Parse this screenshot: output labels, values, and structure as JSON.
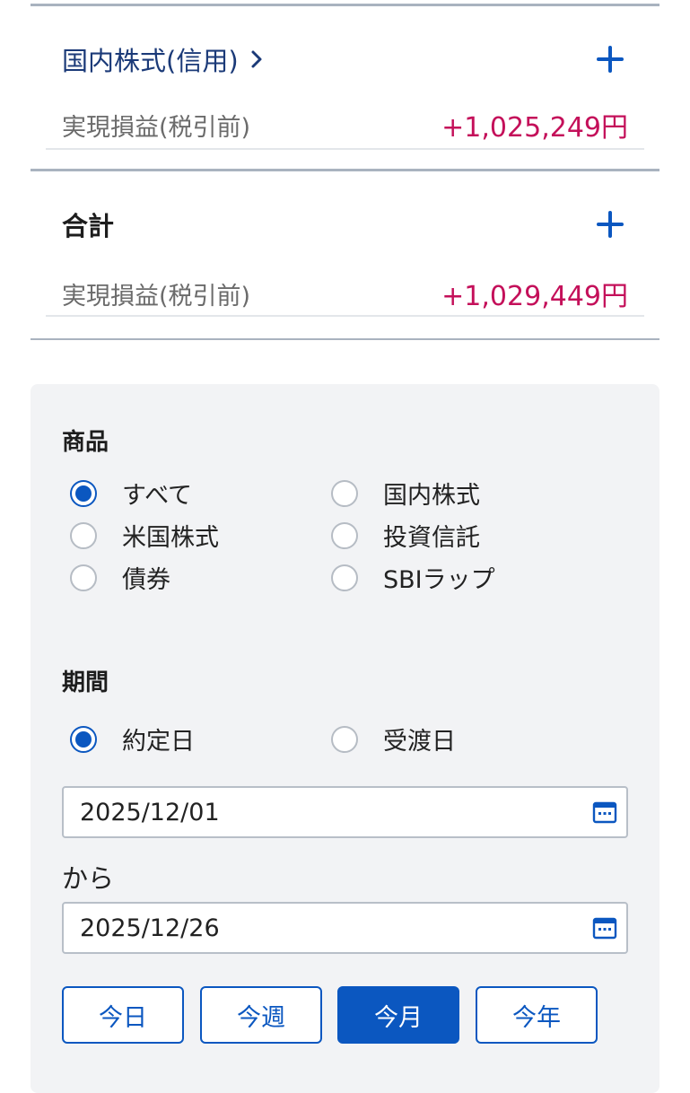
{
  "cards": [
    {
      "title": "国内株式(信用)",
      "has_chevron": true,
      "value_label": "実現損益(税引前)",
      "value": "+1,025,249円"
    },
    {
      "title": "合計",
      "has_chevron": false,
      "value_label": "実現損益(税引前)",
      "value": "+1,029,449円"
    }
  ],
  "filter": {
    "product": {
      "title": "商品",
      "options": [
        {
          "label": "すべて",
          "checked": true
        },
        {
          "label": "国内株式",
          "checked": false
        },
        {
          "label": "米国株式",
          "checked": false
        },
        {
          "label": "投資信託",
          "checked": false
        },
        {
          "label": "債券",
          "checked": false
        },
        {
          "label": "SBIラップ",
          "checked": false
        }
      ]
    },
    "period": {
      "title": "期間",
      "options": [
        {
          "label": "約定日",
          "checked": true
        },
        {
          "label": "受渡日",
          "checked": false
        }
      ],
      "start_date": "2025/12/01",
      "from_text": "から",
      "end_date": "2025/12/26",
      "quick_buttons": [
        {
          "label": "今日",
          "active": false
        },
        {
          "label": "今週",
          "active": false
        },
        {
          "label": "今月",
          "active": true
        },
        {
          "label": "今年",
          "active": false
        }
      ]
    }
  },
  "colors": {
    "accent": "#0b57c0",
    "profit": "#c4105a",
    "title_blue": "#1b3a78"
  },
  "icons": [
    "chevron-right-icon",
    "plus-icon",
    "calendar-icon"
  ]
}
